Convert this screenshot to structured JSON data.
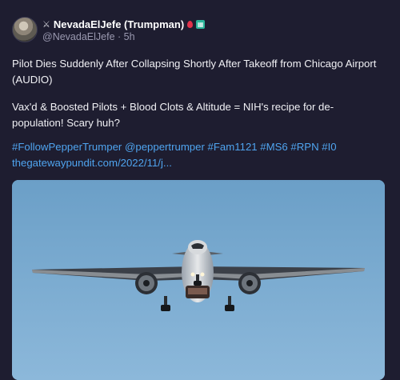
{
  "author": {
    "display_name": "NevadaElJefe (Trumpman)",
    "handle": "@NevadaElJefe",
    "separator": "·",
    "time": "5h",
    "badge_glyph": "▦"
  },
  "post": {
    "headline": "Pilot Dies Suddenly After Collapsing Shortly After Takeoff from Chicago Airport (AUDIO)",
    "comment": "Vax'd & Boosted Pilots + Blood Clots & Altitude = NIH's recipe for de-population! Scary huh?",
    "hashtags": [
      "#FollowPepperTrumper",
      "@peppertrumper",
      "#Fam1121",
      "#MS6",
      "#RPN",
      "#I0"
    ],
    "link": "thegatewaypundit.com/2022/11/j..."
  },
  "icons": {
    "avatar": "user-avatar",
    "prefix": "crossed-swords-icon",
    "drop": "blood-drop-icon",
    "badge": "emoji-badge-icon"
  },
  "colors": {
    "background": "#1e1d30",
    "link": "#4fa4ef",
    "muted": "#9a99b0",
    "sky": "#76a9cf"
  }
}
